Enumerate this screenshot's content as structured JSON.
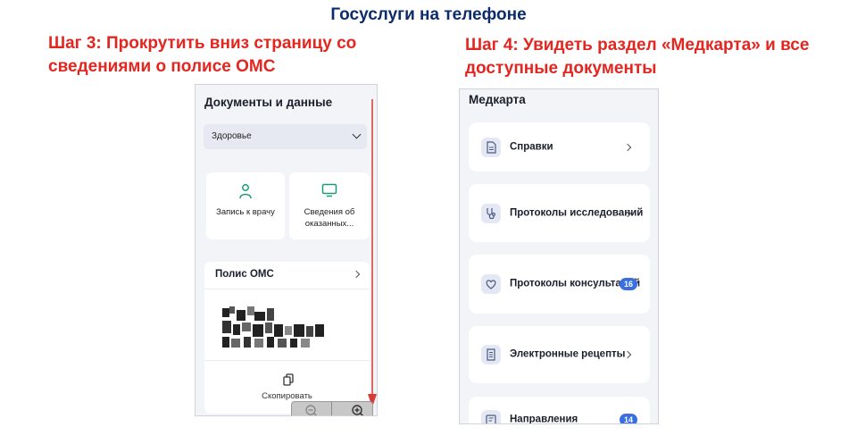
{
  "slide": {
    "title": "Госуслуги на телефоне",
    "step3": "Шаг 3:  Прокрутить  вниз страницу со сведениями о полисе ОМС",
    "step4": "Шаг 4: Увидеть раздел «Медкарта» и все доступные документы"
  },
  "phone1": {
    "title": "Документы и данные",
    "select_value": "Здоровье",
    "tiles": [
      {
        "label": "Запись к врачу",
        "icon": "doctor-icon"
      },
      {
        "label": "Сведения об оказанных...",
        "icon": "monitor-icon"
      }
    ],
    "polis_title": "Полис ОМС",
    "copy_label": "Скопировать"
  },
  "phone2": {
    "title": "Медкарта",
    "items": [
      {
        "label": "Справки",
        "icon": "document-icon"
      },
      {
        "label": "Протоколы исследований",
        "icon": "stethoscope-icon"
      },
      {
        "label": "Протоколы консультаций",
        "icon": "heart-icon",
        "badge": "16"
      },
      {
        "label": "Электронные рецепты",
        "icon": "prescription-icon"
      },
      {
        "label": "Направления",
        "icon": "referral-icon",
        "badge": "14"
      }
    ]
  },
  "colors": {
    "title": "#0d2c6c",
    "steps": "#e3261f",
    "accent": "#3a6fe0",
    "icon_green": "#1a9a7a"
  }
}
